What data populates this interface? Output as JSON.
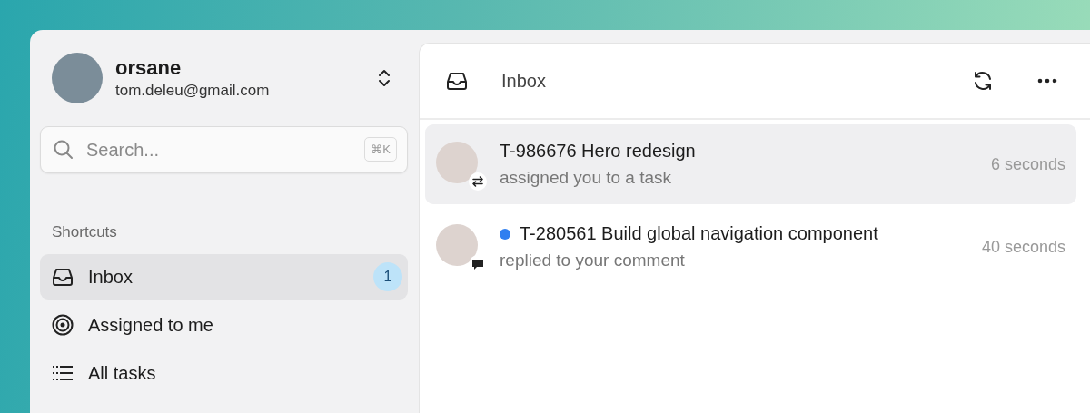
{
  "account": {
    "name": "orsane",
    "email": "tom.deleu@gmail.com"
  },
  "search": {
    "placeholder": "Search...",
    "shortcut": "⌘K"
  },
  "shortcuts": {
    "heading": "Shortcuts",
    "items": [
      {
        "kind": "inbox",
        "label": "Inbox",
        "badge": "1",
        "selected": true
      },
      {
        "kind": "target",
        "label": "Assigned to me",
        "selected": false
      },
      {
        "kind": "list",
        "label": "All tasks",
        "selected": false
      }
    ]
  },
  "main": {
    "title": "Inbox"
  },
  "notifications": [
    {
      "kind": "assign",
      "title": "T-986676 Hero redesign",
      "subtitle": "assigned you to a task",
      "time": "6 seconds",
      "unread": false,
      "selected": true
    },
    {
      "kind": "comment",
      "title": "T-280561 Build global navigation component",
      "subtitle": "replied to your comment",
      "time": "40 seconds",
      "unread": true,
      "selected": false
    }
  ]
}
